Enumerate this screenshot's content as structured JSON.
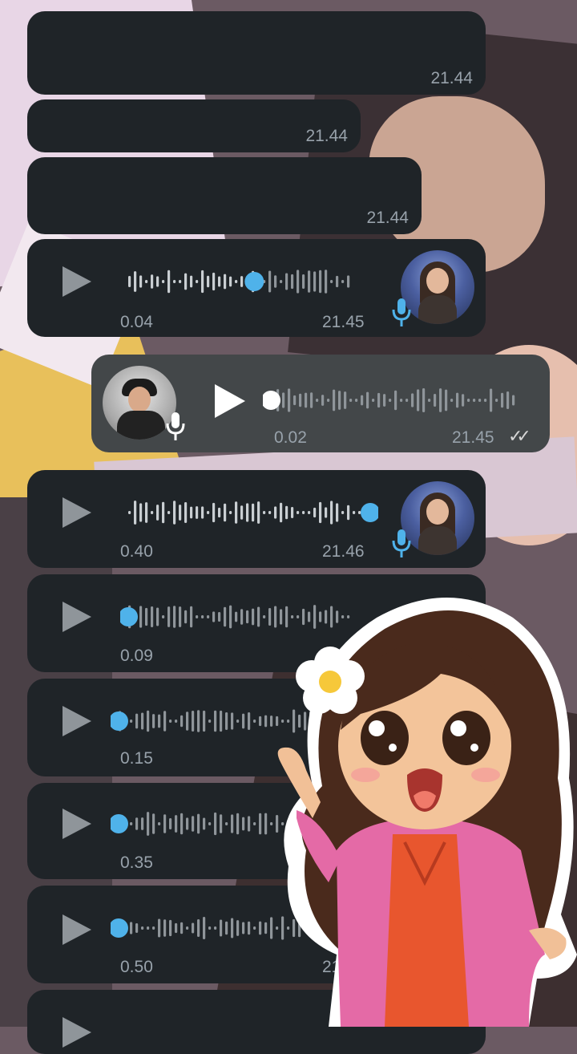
{
  "messages": [
    {
      "kind": "text",
      "time": "21.44"
    },
    {
      "kind": "text",
      "time": "21.44"
    },
    {
      "kind": "text",
      "time": "21.44"
    },
    {
      "kind": "voice",
      "duration": "0.04",
      "time": "21.45",
      "progress": 0.55
    },
    {
      "kind": "voice_out",
      "duration": "0.02",
      "time": "21.45",
      "progress": 0.0
    },
    {
      "kind": "voice",
      "duration": "0.40",
      "time": "21.46",
      "progress": 1.0
    },
    {
      "kind": "voice",
      "duration": "0.09",
      "time": "",
      "progress": 0.0
    },
    {
      "kind": "voice",
      "duration": "0.15",
      "time": "",
      "progress": 0.0
    },
    {
      "kind": "voice",
      "duration": "0.35",
      "time": "",
      "progress": 0.0
    },
    {
      "kind": "voice",
      "duration": "0.50",
      "time": "21",
      "progress": 0.0
    }
  ],
  "colors": {
    "accent": "#4fb2ea",
    "bubble": "#1f2428",
    "bubble_out": "#434749",
    "wave": "#8f959a"
  },
  "icons": {
    "play": "play-icon",
    "mic": "mic-icon",
    "read": "double-check-icon"
  }
}
